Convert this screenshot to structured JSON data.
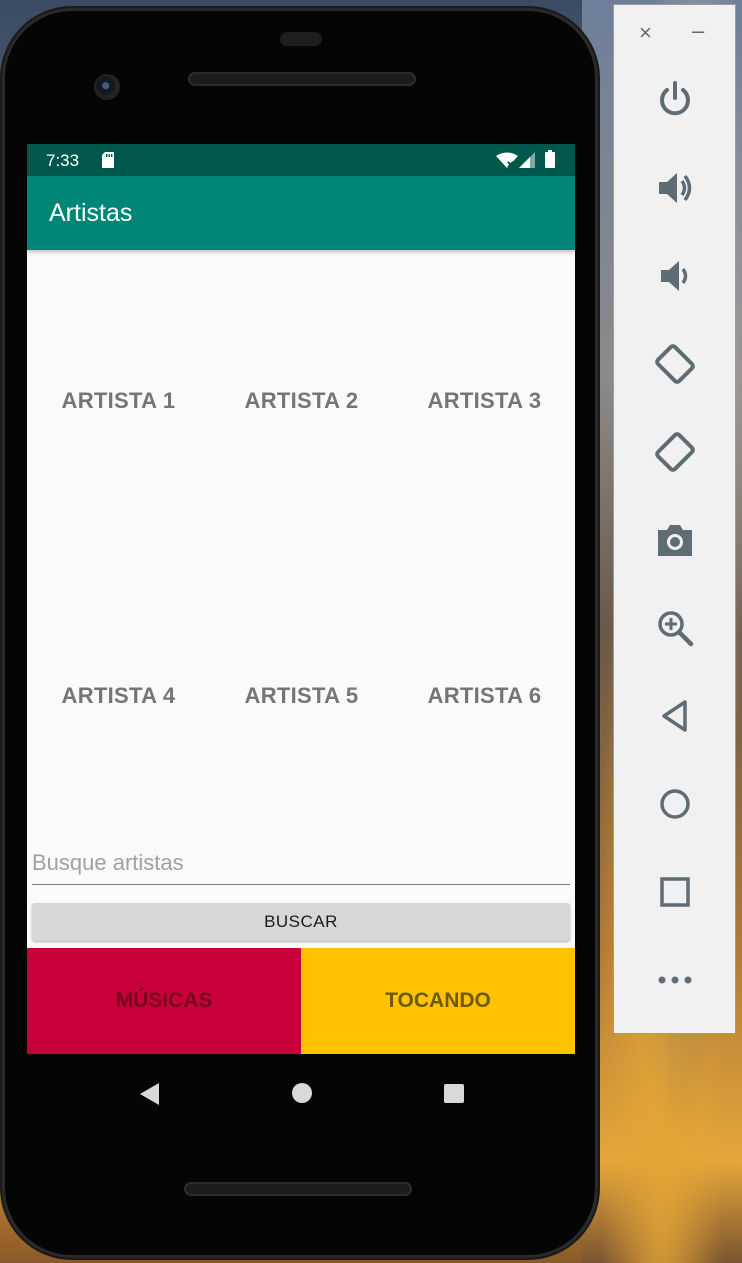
{
  "status_bar": {
    "time": "7:33"
  },
  "app_bar": {
    "title": "Artistas"
  },
  "artists": [
    "ARTISTA 1",
    "ARTISTA 2",
    "ARTISTA 3",
    "ARTISTA 4",
    "ARTISTA 5",
    "ARTISTA 6"
  ],
  "search": {
    "placeholder": "Busque artistas",
    "value": ""
  },
  "buttons": {
    "search_label": "BUSCAR"
  },
  "tabs": {
    "musicas_label": "MÚSICAS",
    "tocando_label": "TOCANDO"
  },
  "colors": {
    "status_bar": "#00574b",
    "app_bar": "#008577",
    "tab_musicas": "#c8003a",
    "tab_tocando": "#ffc200"
  },
  "emulator_toolbar": {
    "window_controls": {
      "close": "×",
      "minimize": "–"
    },
    "tools": [
      "power-icon",
      "volume-up-icon",
      "volume-down-icon",
      "rotate-left-icon",
      "rotate-right-icon",
      "camera-icon",
      "zoom-icon",
      "back-icon",
      "home-icon",
      "overview-icon",
      "more-icon"
    ]
  }
}
